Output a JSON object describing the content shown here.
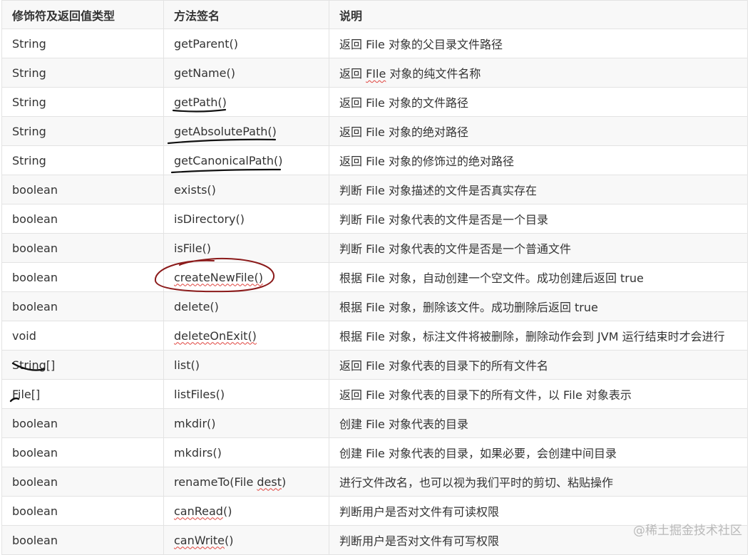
{
  "headers": [
    "修饰符及返回值类型",
    "方法签名",
    "说明"
  ],
  "rows": [
    {
      "type": "String",
      "method": "getParent()",
      "desc": "返回 File 对象的父目录文件路径"
    },
    {
      "type": "String",
      "method": "getName()",
      "desc_pre": "返回 ",
      "desc_mark": "FIle",
      "desc_post": " 对象的纯文件名称"
    },
    {
      "type": "String",
      "method": "getPath()",
      "desc": "返回 File 对象的文件路径"
    },
    {
      "type": "String",
      "method": "getAbsolutePath()",
      "desc": "返回 File 对象的绝对路径"
    },
    {
      "type": "String",
      "method": "getCanonicalPath()",
      "desc": "返回 File 对象的修饰过的绝对路径"
    },
    {
      "type": "boolean",
      "method": "exists()",
      "desc": "判断 File 对象描述的文件是否真实存在"
    },
    {
      "type": "boolean",
      "method": "isDirectory()",
      "desc": "判断 File 对象代表的文件是否是一个目录"
    },
    {
      "type": "boolean",
      "method": "isFile()",
      "desc": "判断 File 对象代表的文件是否是一个普通文件"
    },
    {
      "type": "boolean",
      "method": "createNewFile()",
      "desc": "根据 File 对象，自动创建一个空文件。成功创建后返回 true"
    },
    {
      "type": "boolean",
      "method": "delete()",
      "desc": "根据 File 对象，删除该文件。成功删除后返回 true"
    },
    {
      "type": "void",
      "method": "deleteOnExit()",
      "desc": "根据 File 对象，标注文件将被删除，删除动作会到 JVM 运行结束时才会进行"
    },
    {
      "type": "String[]",
      "method": "list()",
      "desc": "返回 File 对象代表的目录下的所有文件名"
    },
    {
      "type": "File[]",
      "method": "listFiles()",
      "desc": "返回 File 对象代表的目录下的所有文件，以 File 对象表示"
    },
    {
      "type": "boolean",
      "method": "mkdir()",
      "desc": "创建 File 对象代表的目录"
    },
    {
      "type": "boolean",
      "method": "mkdirs()",
      "desc": "创建 File 对象代表的目录，如果必要，会创建中间目录"
    },
    {
      "type": "boolean",
      "method_pre": "renameTo(File ",
      "method_mark": "dest",
      "method_post": ")",
      "desc": "进行文件改名，也可以视为我们平时的剪切、粘贴操作"
    },
    {
      "type": "boolean",
      "method_mark": "canRead",
      "method_post": "()",
      "desc": "判断用户是否对文件有可读权限"
    },
    {
      "type": "boolean",
      "method_mark": "canWrite",
      "method_post": "()",
      "desc": "判断用户是否对文件有可写权限"
    }
  ],
  "watermark": "@稀土掘金技术社区",
  "colors": {
    "ink_black": "#111111",
    "ink_red": "#8b1a1a",
    "spell_red": "#e0443e",
    "border": "#e3e3e3",
    "stripe": "#f8f8f8"
  }
}
